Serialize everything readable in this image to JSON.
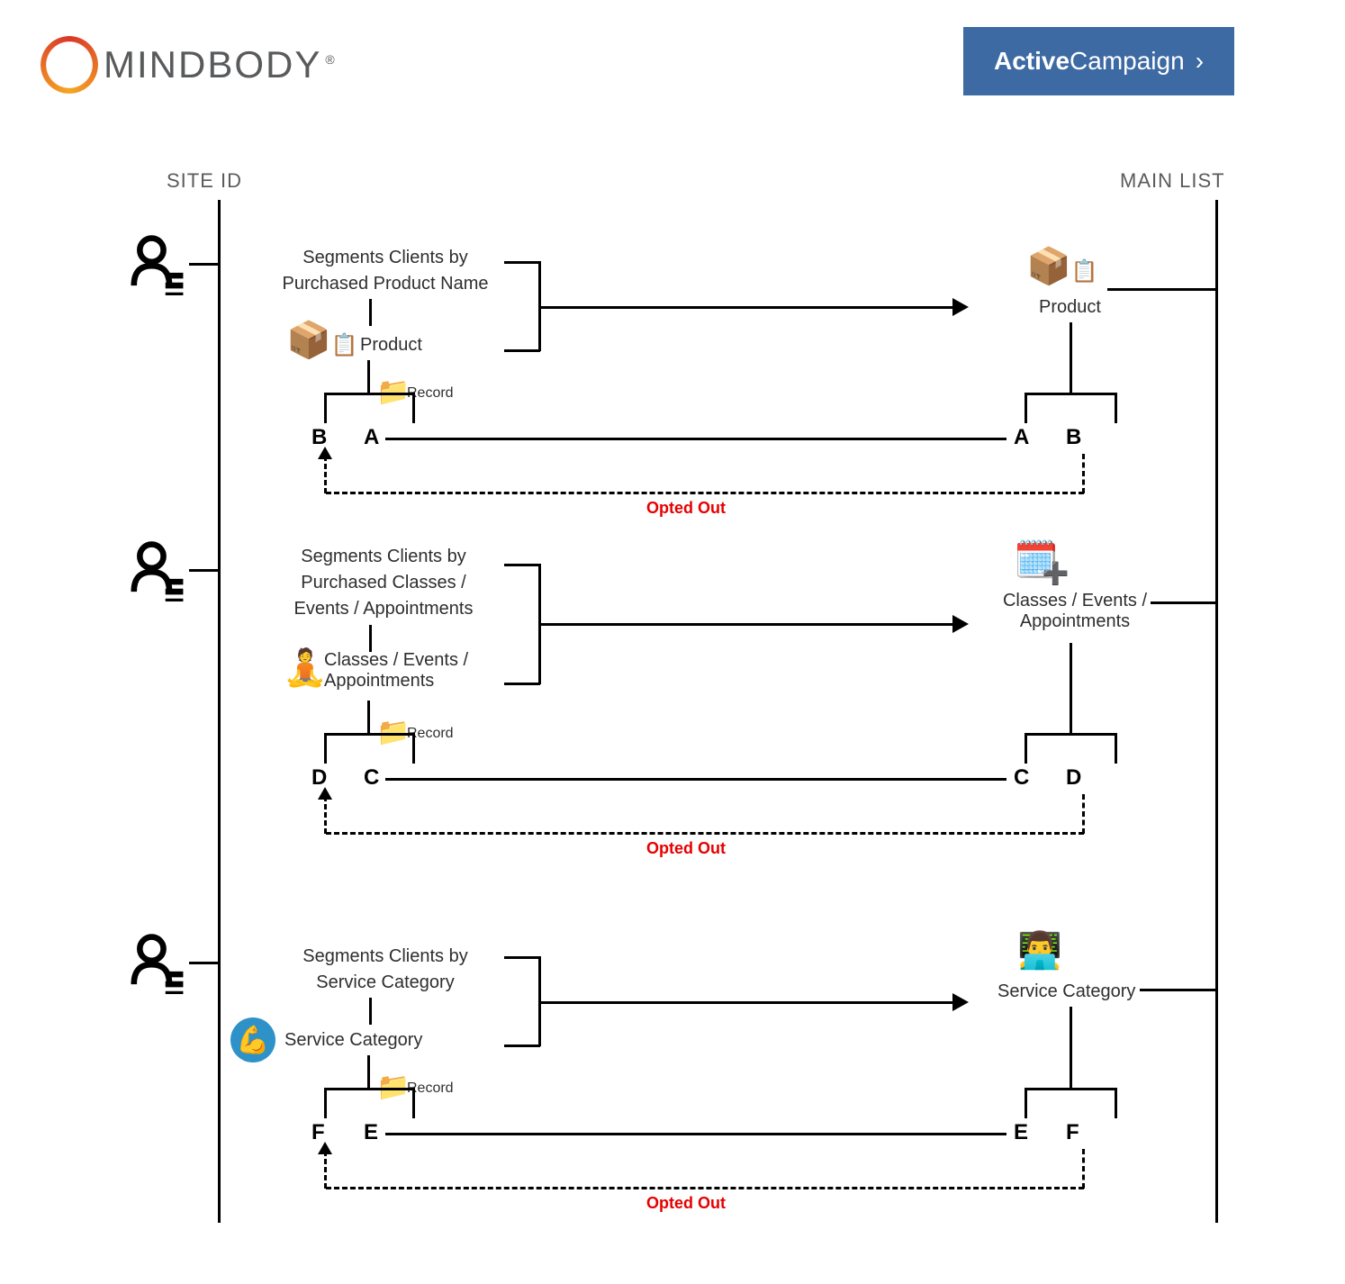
{
  "logos": {
    "mindbody_bold": "MIND",
    "mindbody_rest": "BODY",
    "mindbody_reg": "®",
    "ac_bold": "Active",
    "ac_rest": "Campaign",
    "ac_arrow": "›"
  },
  "headers": {
    "left": "SITE ID",
    "right": "MAIN LIST"
  },
  "sections": [
    {
      "segment_line1": "Segments Clients by",
      "segment_line2": "Purchased Product Name",
      "left_node": "Product",
      "record": "Record",
      "left_letter_outer": "B",
      "left_letter_inner": "A",
      "right_node": "Product",
      "right_letter_inner": "A",
      "right_letter_outer": "B",
      "opted": "Opted Out"
    },
    {
      "segment_line1": "Segments Clients by",
      "segment_line2": "Purchased Classes /",
      "segment_line3": "Events / Appointments",
      "left_node_line1": "Classes / Events /",
      "left_node_line2": "Appointments",
      "record": "Record",
      "left_letter_outer": "D",
      "left_letter_inner": "C",
      "right_node_line1": "Classes / Events /",
      "right_node_line2": "Appointments",
      "right_letter_inner": "C",
      "right_letter_outer": "D",
      "opted": "Opted Out"
    },
    {
      "segment_line1": "Segments Clients by",
      "segment_line2": "Service Category",
      "left_node": "Service Category",
      "record": "Record",
      "left_letter_outer": "F",
      "left_letter_inner": "E",
      "right_node": "Service Category",
      "right_letter_inner": "E",
      "right_letter_outer": "F",
      "opted": "Opted Out"
    }
  ]
}
